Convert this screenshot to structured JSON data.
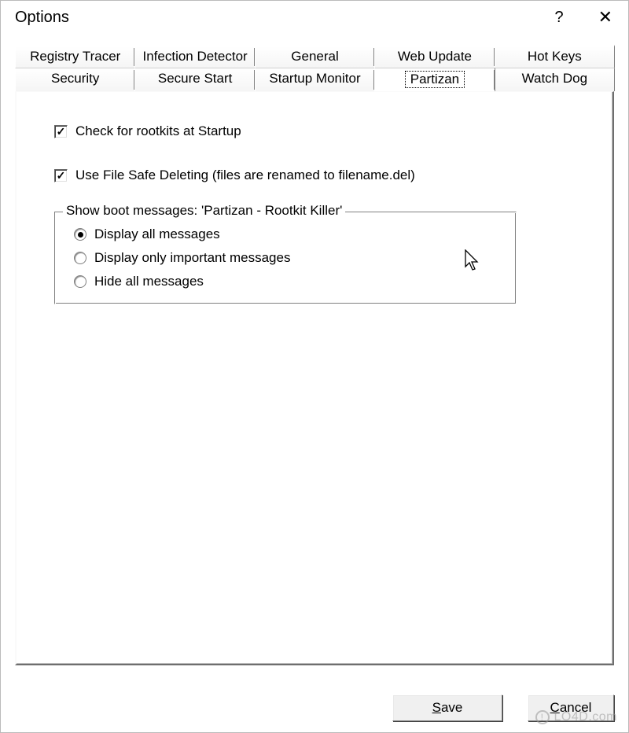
{
  "window": {
    "title": "Options",
    "help_symbol": "?",
    "close_symbol": "✕"
  },
  "tabs_row1": [
    {
      "label": "Registry Tracer"
    },
    {
      "label": "Infection Detector"
    },
    {
      "label": "General"
    },
    {
      "label": "Web Update"
    },
    {
      "label": "Hot Keys"
    }
  ],
  "tabs_row2": [
    {
      "label": "Security"
    },
    {
      "label": "Secure Start"
    },
    {
      "label": "Startup Monitor"
    },
    {
      "label": "Partizan",
      "selected": true
    },
    {
      "label": "Watch Dog"
    }
  ],
  "panel": {
    "check_rootkits": {
      "label": "Check for rootkits at Startup",
      "checked": true
    },
    "file_safe_delete": {
      "label": "Use File Safe Deleting (files are renamed to filename.del)",
      "checked": true
    },
    "groupbox": {
      "legend": "Show boot messages: 'Partizan - Rootkit Killer'",
      "options": [
        {
          "label": "Display all messages",
          "selected": true
        },
        {
          "label": "Display only important messages",
          "selected": false
        },
        {
          "label": "Hide all messages",
          "selected": false
        }
      ]
    }
  },
  "buttons": {
    "save_prefix": "S",
    "save_rest": "ave",
    "cancel_prefix": "C",
    "cancel_rest": "ancel"
  },
  "watermark": {
    "text": "LO4D.com",
    "icon": "!"
  }
}
